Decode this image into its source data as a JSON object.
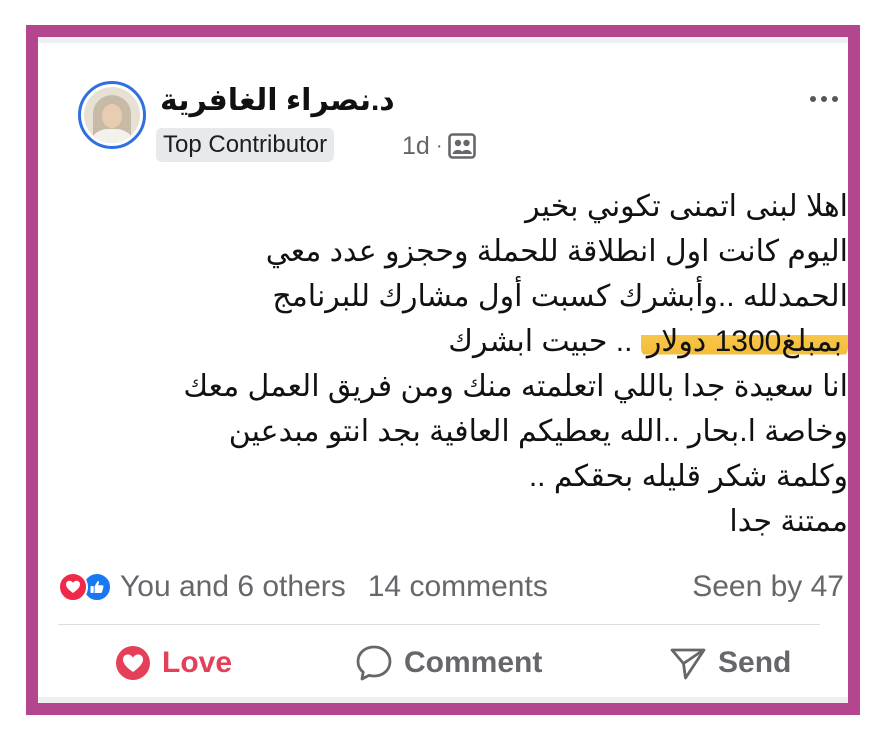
{
  "post": {
    "author_name": "د.نصراء الغافرية",
    "badge": "Top Contributor",
    "time": "1d",
    "separator": "·",
    "audience_icon": "friends-audience-icon",
    "lines": [
      "اهلا لبنى اتمنى تكوني بخير",
      "اليوم كانت اول انطلاقة للحملة وحجزو عدد معي",
      "الحمدلله ..وأبشرك كسبت أول مشارك للبرنامج",
      {
        "highlighted": "بمبلغ1300 دولار",
        "rest": " .. حبيت ابشرك"
      },
      "انا سعيدة جدا باللي اتعلمته منك ومن فريق العمل معك",
      "وخاصة ا.بحار ..الله يعطيكم العافية بجد انتو مبدعين",
      "وكلمة شكر قليله بحقكم ..",
      "ممتنة جدا"
    ],
    "highlight_color": "#f5c042"
  },
  "stats": {
    "reactions": [
      "love-react-icon",
      "like-react-icon"
    ],
    "reaction_text": "You and 6 others",
    "comments": "14 comments",
    "seen": "Seen by 47"
  },
  "actions": {
    "love": "Love",
    "comment": "Comment",
    "send": "Send"
  },
  "colors": {
    "frame": "#b4458f",
    "love": "#e4405a",
    "like": "#1877f2",
    "avatar_ring": "#2f6fe0",
    "muted_text": "#65676b"
  }
}
